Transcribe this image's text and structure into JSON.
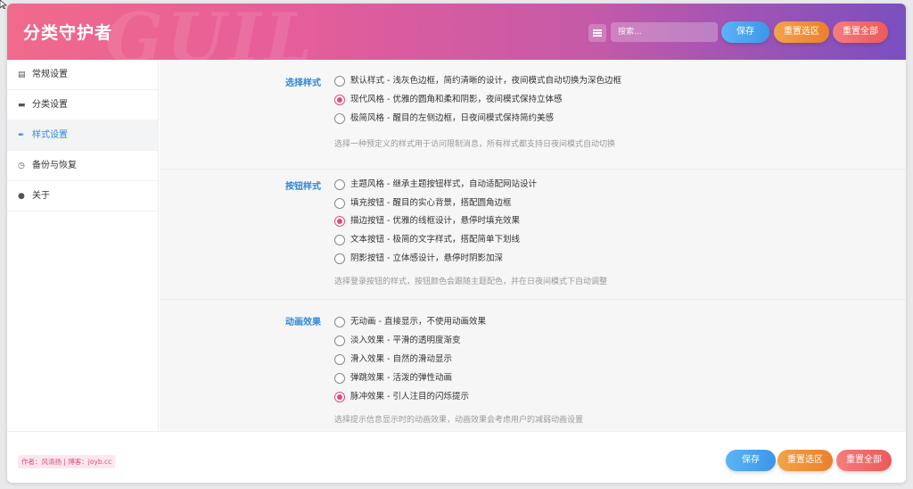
{
  "header": {
    "title": "分类守护者",
    "search_placeholder": "搜索...",
    "save_label": "保存",
    "reset_section_label": "重置选区",
    "reset_all_label": "重置全部"
  },
  "sidebar": {
    "items": [
      {
        "label": "常规设置",
        "icon": "settings-icon"
      },
      {
        "label": "分类设置",
        "icon": "folder-icon"
      },
      {
        "label": "样式设置",
        "icon": "brush-icon",
        "active": true
      },
      {
        "label": "备份与恢复",
        "icon": "history-icon"
      },
      {
        "label": "关于",
        "icon": "info-icon"
      }
    ]
  },
  "sections": [
    {
      "label": "选择样式",
      "options": [
        {
          "text": "默认样式 - 浅灰色边框，简约清晰的设计，夜间模式自动切换为深色边框",
          "checked": false
        },
        {
          "text": "现代风格 - 优雅的圆角和柔和阴影，夜间模式保持立体感",
          "checked": true
        },
        {
          "text": "极简风格 - 醒目的左侧边框，日夜间模式保持简约美感",
          "checked": false
        }
      ],
      "hint": "选择一种预定义的样式用于访问限制消息，所有样式都支持日夜间模式自动切换"
    },
    {
      "label": "按钮样式",
      "options": [
        {
          "text": "主题风格 - 继承主题按钮样式，自动适配网站设计",
          "checked": false
        },
        {
          "text": "填充按钮 - 醒目的实心背景，搭配圆角边框",
          "checked": false
        },
        {
          "text": "描边按钮 - 优雅的线框设计，悬停时填充效果",
          "checked": true
        },
        {
          "text": "文本按钮 - 极简的文字样式，搭配简单下划线",
          "checked": false
        },
        {
          "text": "阴影按钮 - 立体感设计，悬停时阴影加深",
          "checked": false
        }
      ],
      "hint": "选择登录按钮的样式，按钮颜色会跟随主题配色，并在日夜间模式下自动调整"
    },
    {
      "label": "动画效果",
      "options": [
        {
          "text": "无动画 - 直接显示，不使用动画效果",
          "checked": false
        },
        {
          "text": "淡入效果 - 平滑的透明度渐变",
          "checked": false
        },
        {
          "text": "滑入效果 - 自然的滑动显示",
          "checked": false
        },
        {
          "text": "弹跳效果 - 活泼的弹性动画",
          "checked": false
        },
        {
          "text": "脉冲效果 - 引人注目的闪烁提示",
          "checked": true
        }
      ],
      "hint": "选择提示信息显示时的动画效果，动画效果会考虑用户的减弱动画设置"
    }
  ],
  "footer": {
    "credit": "作者：风清扬 | 博客：joyb.cc",
    "save_label": "保存",
    "reset_section_label": "重置选区",
    "reset_all_label": "重置全部"
  },
  "colors": {
    "accent": "#2f86d8",
    "radio_checked": "#e24b7d",
    "header_gradient": [
      "#f06a8c",
      "#7a4fc0"
    ]
  }
}
